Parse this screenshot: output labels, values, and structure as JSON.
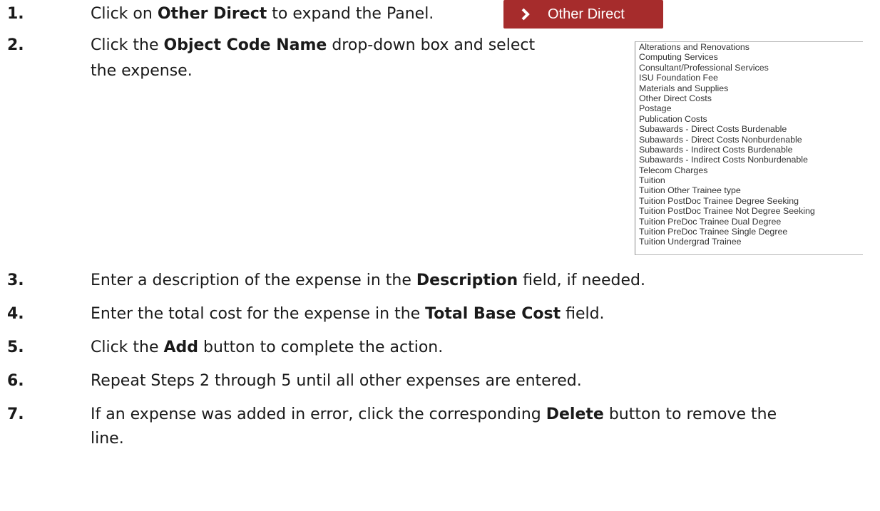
{
  "steps": [
    {
      "num": "1.",
      "parts": [
        {
          "t": "Click on "
        },
        {
          "t": "Other Direct",
          "b": true
        },
        {
          "t": " to expand the Panel."
        }
      ]
    },
    {
      "num": "2.",
      "lines": [
        [
          {
            "t": "Click the "
          },
          {
            "t": "Object Code Name",
            "b": true
          },
          {
            "t": " drop-down box and select"
          }
        ],
        [
          {
            "t": "the expense."
          }
        ]
      ]
    },
    {
      "num": "3.",
      "parts": [
        {
          "t": "Enter a description of the expense in the "
        },
        {
          "t": "Description",
          "b": true
        },
        {
          "t": " field, if needed."
        }
      ]
    },
    {
      "num": "4.",
      "parts": [
        {
          "t": "Enter the total cost for the expense in the "
        },
        {
          "t": "Total Base Cost",
          "b": true
        },
        {
          "t": " field."
        }
      ]
    },
    {
      "num": "5.",
      "parts": [
        {
          "t": "Click the "
        },
        {
          "t": "Add",
          "b": true
        },
        {
          "t": " button to complete the action."
        }
      ]
    },
    {
      "num": "6.",
      "parts": [
        {
          "t": "Repeat Steps 2 through 5 until all other expenses are entered."
        }
      ]
    },
    {
      "num": "7.",
      "lines": [
        [
          {
            "t": "If an expense was added in error, click the corresponding "
          },
          {
            "t": "Delete",
            "b": true
          },
          {
            "t": " button to remove the"
          }
        ],
        [
          {
            "t": "line."
          }
        ]
      ]
    }
  ],
  "panel_button": {
    "label": "Other Direct",
    "icon": "chevron-right-icon",
    "color": "#a62c2c"
  },
  "object_code_options": [
    "Alterations and Renovations",
    "Computing Services",
    "Consultant/Professional Services",
    "ISU Foundation Fee",
    "Materials and Supplies",
    "Other Direct Costs",
    "Postage",
    "Publication Costs",
    "Subawards - Direct Costs Burdenable",
    "Subawards - Direct Costs Nonburdenable",
    "Subawards - Indirect Costs Burdenable",
    "Subawards - Indirect Costs Nonburdenable",
    "Telecom Charges",
    "Tuition",
    "Tuition Other Trainee type",
    "Tuition PostDoc Trainee Degree Seeking",
    "Tuition PostDoc Trainee Not Degree Seeking",
    "Tuition PreDoc Trainee Dual Degree",
    "Tuition PreDoc Trainee Single Degree",
    "Tuition Undergrad Trainee"
  ]
}
